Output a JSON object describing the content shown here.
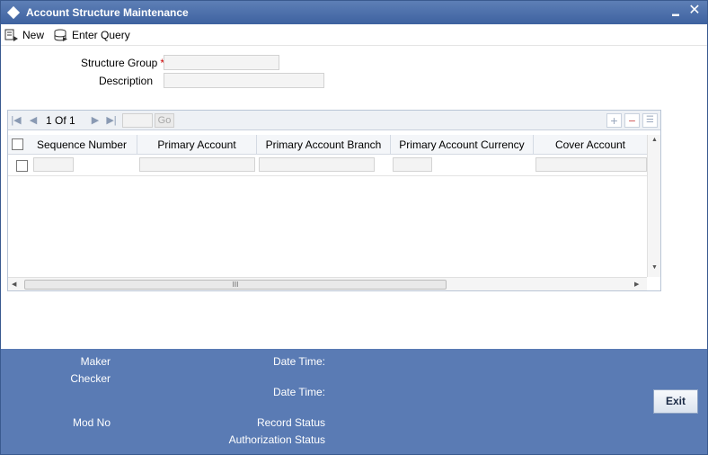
{
  "window": {
    "title": "Account Structure Maintenance",
    "minimize_glyph": "▬",
    "close_glyph": "✕"
  },
  "toolbar": {
    "new_label": "New",
    "enter_query_label": "Enter Query"
  },
  "form": {
    "structure_group_label": "Structure Group",
    "required_marker": "*",
    "structure_group_value": "",
    "description_label": "Description",
    "description_value": ""
  },
  "grid": {
    "pager": {
      "current_page": "1",
      "of_label": "Of",
      "total_pages": "1",
      "go_label": "Go",
      "page_input_value": ""
    },
    "columns": [
      "Sequence Number",
      "Primary Account",
      "Primary Account Branch",
      "Primary Account Currency",
      "Cover Account"
    ],
    "rows": [
      [
        "",
        "",
        "",
        "",
        ""
      ]
    ],
    "scroll_thumb_glyph": "III"
  },
  "footer": {
    "maker_label": "Maker",
    "checker_label": "Checker",
    "date_time_label": "Date Time:",
    "mod_no_label": "Mod No",
    "record_status_label": "Record Status",
    "authorization_status_label": "Authorization Status",
    "exit_label": "Exit"
  },
  "colors": {
    "title_bar": "#4a6eaa",
    "footer": "#5a7bb4",
    "required": "#cc0000"
  }
}
